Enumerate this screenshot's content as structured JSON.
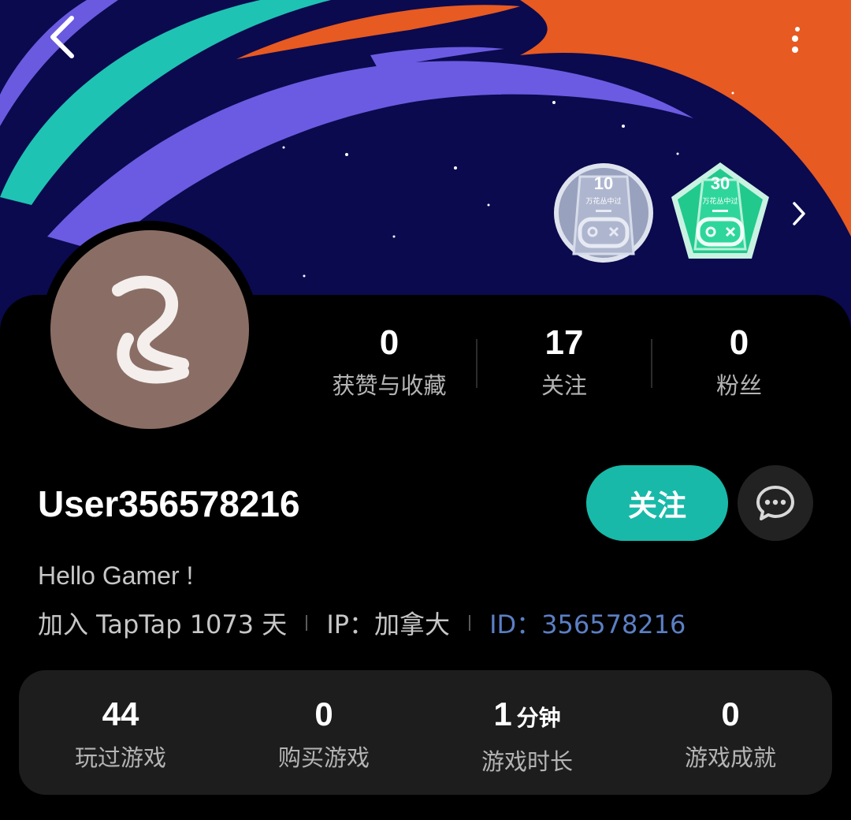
{
  "profile": {
    "username": "User356578216",
    "bio": "Hello Gamer !",
    "joined": "加入 TapTap 1073 天",
    "ip": "IP：加拿大",
    "id": "ID：356578216"
  },
  "header_stats": [
    {
      "value": "0",
      "label": "获赞与收藏"
    },
    {
      "value": "17",
      "label": "关注"
    },
    {
      "value": "0",
      "label": "粉丝"
    }
  ],
  "actions": {
    "follow_label": "关注"
  },
  "badges": [
    {
      "number": "10",
      "caption": "万花丛中过",
      "color": "#a8b0c8"
    },
    {
      "number": "30",
      "caption": "万花丛中过",
      "color": "#2fcf9a"
    }
  ],
  "game_stats": [
    {
      "value": "44",
      "unit": "",
      "label": "玩过游戏"
    },
    {
      "value": "0",
      "unit": "",
      "label": "购买游戏"
    },
    {
      "value": "1",
      "unit": "分钟",
      "label": "游戏时长"
    },
    {
      "value": "0",
      "unit": "",
      "label": "游戏成就"
    }
  ],
  "colors": {
    "accent": "#18b9a9",
    "id_link": "#5b7fc4",
    "avatar_bg": "#8a6e65",
    "banner_bg": "#0b0a4e"
  }
}
